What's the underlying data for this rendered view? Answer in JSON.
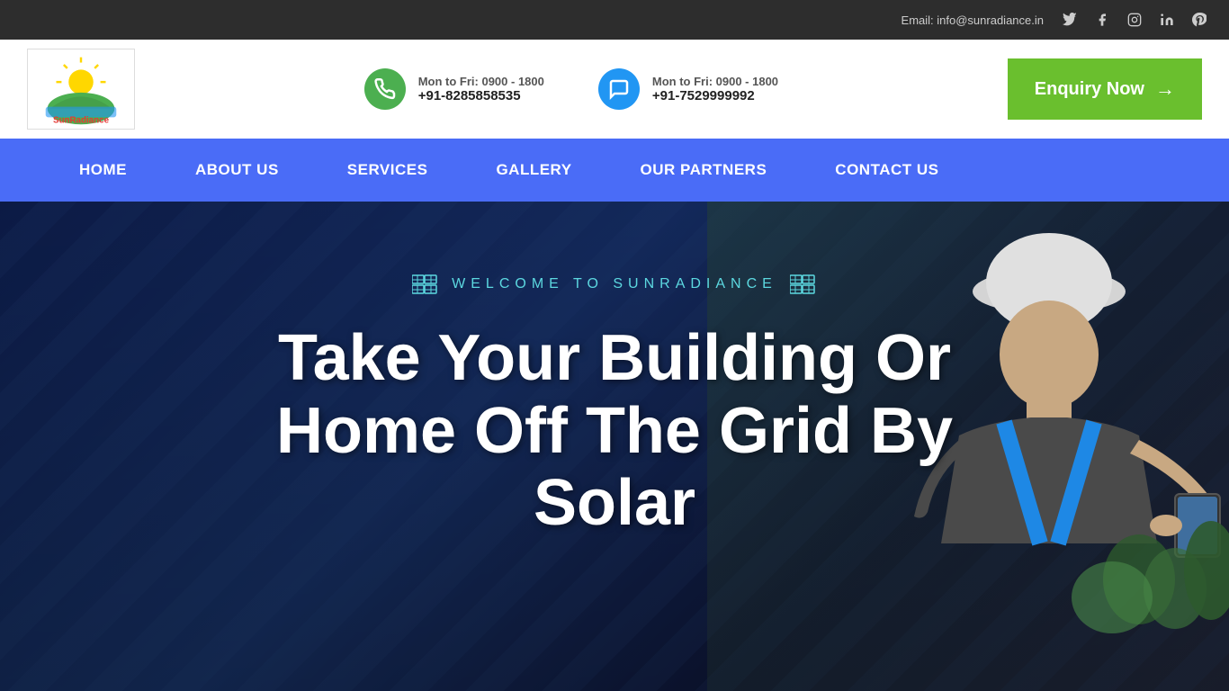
{
  "topbar": {
    "email_label": "Email: info@sunradiance.in",
    "social": [
      "twitter",
      "facebook",
      "instagram",
      "linkedin",
      "pinterest"
    ]
  },
  "header": {
    "logo_text": "SunRadiance",
    "phone1": {
      "label": "Mon to Fri: 0900 - 1800",
      "number": "+91-8285858535"
    },
    "phone2": {
      "label": "Mon to Fri: 0900 - 1800",
      "number": "+91-7529999992"
    },
    "enquiry_btn": "Enquiry Now"
  },
  "navbar": {
    "items": [
      {
        "label": "HOME"
      },
      {
        "label": "ABOUT US"
      },
      {
        "label": "SERVICES"
      },
      {
        "label": "GALLERY"
      },
      {
        "label": "OUR PARTNERS"
      },
      {
        "label": "CONTACT US"
      }
    ]
  },
  "hero": {
    "welcome_text": "WELCOME TO SUNRADIANCE",
    "title_line1": "Take Your Building Or",
    "title_line2": "Home Off The Grid By",
    "title_line3": "Solar"
  }
}
